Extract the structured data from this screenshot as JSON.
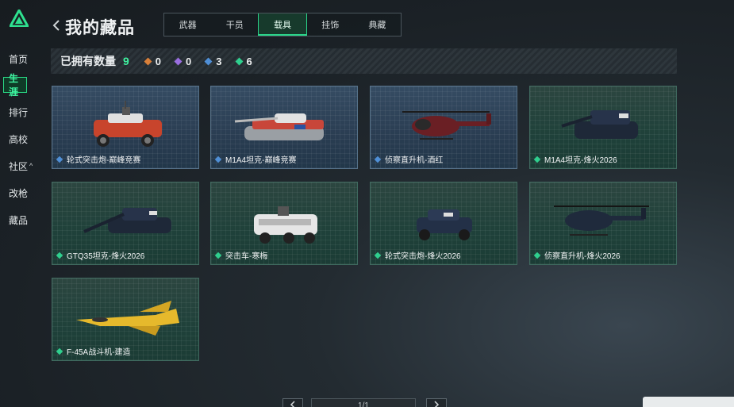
{
  "sidebar": {
    "items": [
      {
        "label": "首页"
      },
      {
        "label": "生涯",
        "active": true
      },
      {
        "label": "排行"
      },
      {
        "label": "高校"
      },
      {
        "label": "社区",
        "caret": "^"
      },
      {
        "label": "改枪"
      },
      {
        "label": "藏品"
      }
    ]
  },
  "header": {
    "back_icon": "chevron-left-icon",
    "title": "我的藏品",
    "tabs": [
      {
        "label": "武器"
      },
      {
        "label": "干员"
      },
      {
        "label": "载具",
        "active": true
      },
      {
        "label": "挂饰"
      },
      {
        "label": "典藏"
      }
    ]
  },
  "owned": {
    "label": "已拥有数量",
    "total": "9",
    "stats": [
      {
        "rarity": "orange",
        "color": "#d9803a",
        "count": "0"
      },
      {
        "rarity": "purple",
        "color": "#9a6ee0",
        "count": "0"
      },
      {
        "rarity": "blue",
        "color": "#4f8fd6",
        "count": "3"
      },
      {
        "rarity": "green",
        "color": "#2fcf8e",
        "count": "6"
      }
    ]
  },
  "collection": {
    "items": [
      {
        "name": "轮式突击炮-巅峰竞赛",
        "rarity": "blue",
        "vehicle": "wheeled-assault-gun"
      },
      {
        "name": "M1A4坦克-巅峰竞赛",
        "rarity": "blue",
        "vehicle": "tank"
      },
      {
        "name": "侦察直升机-酒红",
        "rarity": "blue",
        "vehicle": "helicopter"
      },
      {
        "name": "M1A4坦克-烽火2026",
        "rarity": "green",
        "vehicle": "tank"
      },
      {
        "name": "GTQ35坦克-烽火2026",
        "rarity": "green",
        "vehicle": "tank"
      },
      {
        "name": "突击车-寒梅",
        "rarity": "green",
        "vehicle": "assault-vehicle"
      },
      {
        "name": "轮式突击炮-烽火2026",
        "rarity": "green",
        "vehicle": "wheeled-assault-gun"
      },
      {
        "name": "侦察直升机-烽火2026",
        "rarity": "green",
        "vehicle": "helicopter"
      },
      {
        "name": "F-45A战斗机-建造",
        "rarity": "green",
        "vehicle": "fighter-jet"
      }
    ]
  },
  "pagination": {
    "page_indicator": "1/1",
    "prev_icon": "chevron-left-icon",
    "next_icon": "chevron-right-icon"
  },
  "colors": {
    "accent": "#3ff2a0",
    "rarity_blue": "#4f8fd6",
    "rarity_green": "#2fcf8e"
  }
}
